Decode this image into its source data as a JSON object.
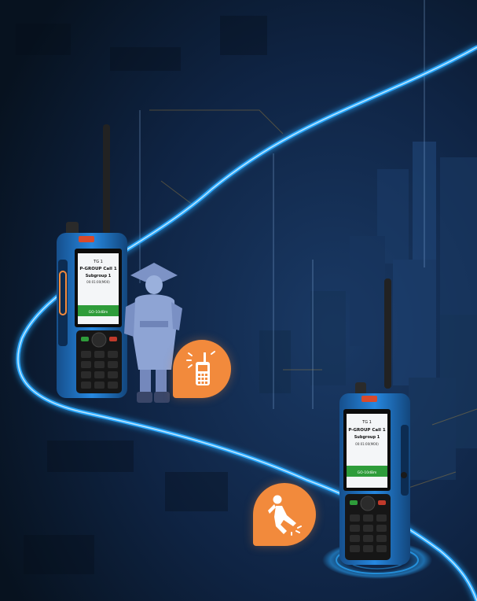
{
  "colors": {
    "background": "#0b1830",
    "route_glow": "#2aa9ff",
    "radio_body": "#1f7fd6",
    "accent_orange": "#f28a3c"
  },
  "radio_left": {
    "screen_lines": [
      "TG 1",
      "P-GROUP Call 1",
      "Subgroup 1",
      "00:01:00(M00)",
      "GO-10dBm"
    ]
  },
  "radio_right": {
    "screen_lines": [
      "TG 1",
      "P-GROUP Call 1",
      "Subgroup 1",
      "00:01:00(M00)",
      "GO-10dBm"
    ]
  },
  "icons": {
    "call_alert": "radio-alert-icon",
    "man_down": "man-down-fall-icon"
  }
}
